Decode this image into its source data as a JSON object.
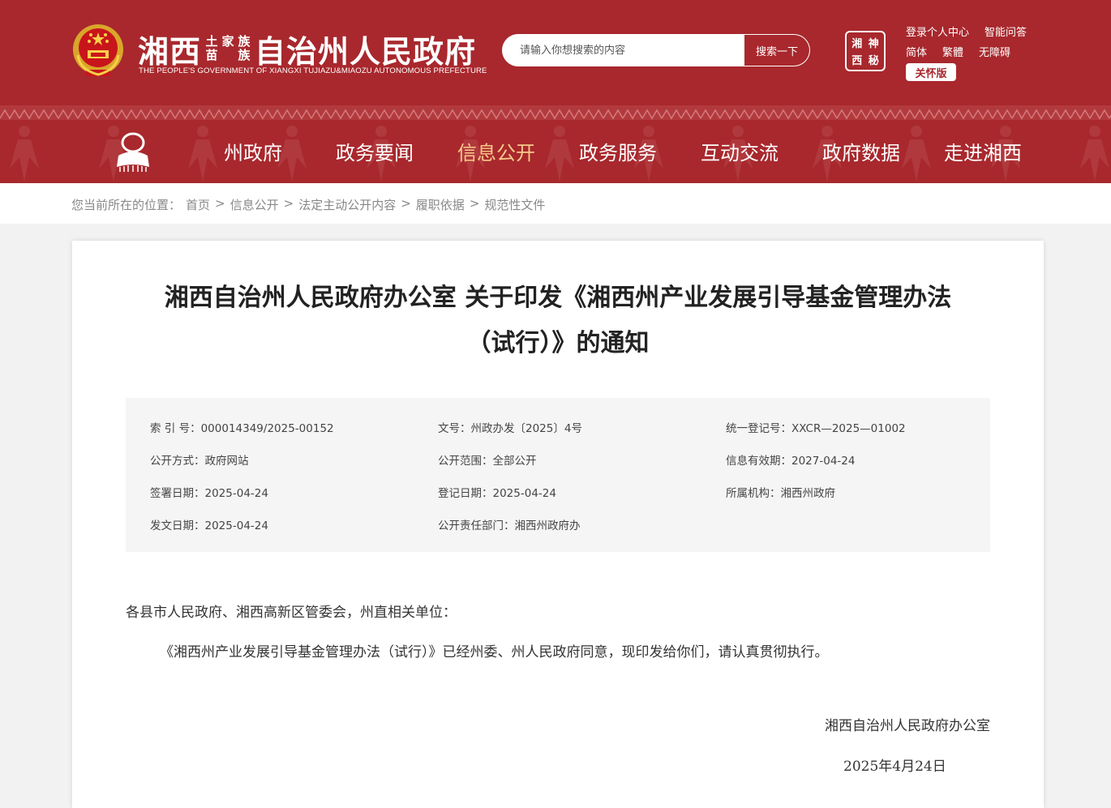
{
  "header": {
    "title_main_left": "湘西",
    "title_small_top": [
      "土",
      "家",
      "族"
    ],
    "title_small_bottom": [
      "苗",
      "族"
    ],
    "title_main_right": "自治州人民政府",
    "subtitle": "THE PEOPLE'S GOVERNMENT OF XIANGXI TUJIAZU&MIAOZU AUTONOMOUS PREFECTURE",
    "search_placeholder": "请输入你想搜索的内容",
    "search_button": "搜索一下",
    "seal_chars": [
      "湘",
      "神",
      "西",
      "秘"
    ],
    "links_row1": [
      "登录个人中心",
      "智能问答"
    ],
    "links_row2": [
      "简体",
      "繁體",
      "无障碍"
    ],
    "care_button": "关怀版"
  },
  "nav": {
    "items": [
      "州政府",
      "政务要闻",
      "信息公开",
      "政务服务",
      "互动交流",
      "政府数据",
      "走进湘西"
    ],
    "active_index": 2
  },
  "breadcrumb": {
    "prefix": "您当前所在的位置：",
    "items": [
      "首页",
      "信息公开",
      "法定主动公开内容",
      "履职依据",
      "规范性文件"
    ],
    "separator": ">"
  },
  "article": {
    "title_line1": "湘西自治州人民政府办公室 关于印发《湘西州产业发展引导基金管理办法",
    "title_line2": "（试行）》的通知",
    "meta": {
      "index_no_label": "索 引 号：",
      "index_no": "000014349/2025-00152",
      "doc_no_label": "文号：",
      "doc_no": "州政办发〔2025〕4号",
      "reg_no_label": "统一登记号：",
      "reg_no": "XXCR—2025—01002",
      "open_method_label": "公开方式：",
      "open_method": "政府网站",
      "open_scope_label": "公开范围：",
      "open_scope": "全部公开",
      "valid_label": "信息有效期：",
      "valid": "2027-04-24",
      "sign_date_label": "签署日期：",
      "sign_date": "2025-04-24",
      "reg_date_label": "登记日期：",
      "reg_date": "2025-04-24",
      "org_label": "所属机构：",
      "org": "湘西州政府",
      "issue_date_label": "发文日期：",
      "issue_date": "2025-04-24",
      "dept_label": "公开责任部门：",
      "dept": "湘西州政府办"
    },
    "salutation": "各县市人民政府、湘西高新区管委会，州直相关单位：",
    "paragraph": "《湘西州产业发展引导基金管理办法（试行）》已经州委、州人民政府同意，现印发给你们，请认真贯彻执行。",
    "signature": "湘西自治州人民政府办公室",
    "date": "2025年4月24日"
  },
  "colors": {
    "brand_red": "#a8282d",
    "nav_active": "#f7c98a"
  }
}
